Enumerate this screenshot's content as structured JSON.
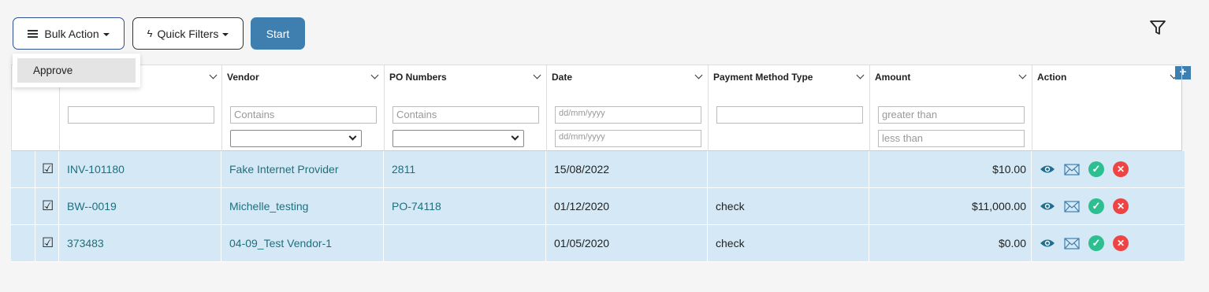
{
  "toolbar": {
    "bulk_action_label": "Bulk Action",
    "quick_filters_label": "Quick Filters",
    "start_label": "Start"
  },
  "bulk_menu": {
    "items": [
      {
        "label": "Approve"
      }
    ]
  },
  "columns": {
    "vendor": {
      "label": "Vendor",
      "filter_placeholder": "Contains"
    },
    "po_numbers": {
      "label": "PO Numbers",
      "filter_placeholder": "Contains"
    },
    "date": {
      "label": "Date",
      "from_placeholder": "dd/mm/yyyy",
      "to_placeholder": "dd/mm/yyyy"
    },
    "payment_method_type": {
      "label": "Payment Method Type"
    },
    "amount": {
      "label": "Amount",
      "min_placeholder": "greater than",
      "max_placeholder": "less than"
    },
    "action": {
      "label": "Action"
    }
  },
  "rows": [
    {
      "checked": "☑",
      "invoice": "INV-101180",
      "vendor": "Fake Internet Provider",
      "po": "2811",
      "date": "15/08/2022",
      "payment_method": "",
      "amount": "$10.00"
    },
    {
      "checked": "☑",
      "invoice": "BW--0019",
      "vendor": "Michelle_testing",
      "po": "PO-74118",
      "date": "01/12/2020",
      "payment_method": "check",
      "amount": "$11,000.00"
    },
    {
      "checked": "☑",
      "invoice": "373483",
      "vendor": "04-09_Test Vendor-1",
      "po": "",
      "date": "01/05/2020",
      "payment_method": "check",
      "amount": "$0.00"
    }
  ],
  "colors": {
    "accent": "#3e7fb0",
    "row_bg": "#d4e9f5",
    "link": "#1e6f7e",
    "approve_green": "#2ebf91",
    "reject_red": "#ef4444"
  },
  "icons": {
    "bulk": "list-lines-icon",
    "quick_filters": "lightning-icon",
    "filter": "funnel-icon",
    "add_column": "plus-icon",
    "view": "eye-icon",
    "email": "envelope-icon",
    "approve": "check-circle-icon",
    "reject": "x-circle-icon"
  }
}
